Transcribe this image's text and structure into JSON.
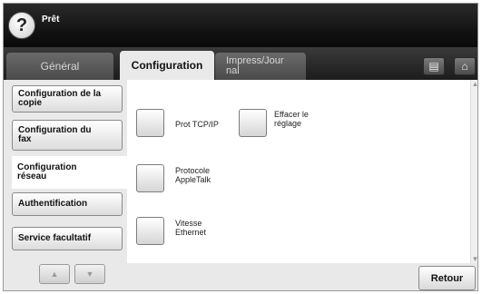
{
  "status": {
    "help_symbol": "?",
    "text": "Prêt"
  },
  "tabs": [
    {
      "label": "Général"
    },
    {
      "label": "Configuration"
    },
    {
      "label_line1": "Impress/Jour",
      "label_line2": "nal"
    }
  ],
  "tab_icons": [
    {
      "name": "copy-job-icon",
      "glyph": "▤"
    },
    {
      "name": "home-icon",
      "glyph": "⌂"
    }
  ],
  "sidebar": {
    "items": [
      {
        "line1": "Configuration de la",
        "line2": "copie"
      },
      {
        "line1": "Configuration du",
        "line2": "fax"
      },
      {
        "line1": "Configuration",
        "line2": "réseau"
      },
      {
        "line1": "Authentification",
        "line2": ""
      },
      {
        "line1": "Service facultatif",
        "line2": ""
      }
    ],
    "active_index": 2,
    "up_arrow": "▲",
    "down_arrow": "▼"
  },
  "options": [
    {
      "line1": "Prot TCP/IP",
      "line2": ""
    },
    {
      "line1": "Effacer le",
      "line2": "réglage"
    },
    {
      "line1": "Protocole",
      "line2": "AppleTalk"
    },
    {
      "line1": "Vitesse",
      "line2": "Ethernet"
    }
  ],
  "scroll": {
    "up": "▲",
    "down": "▼"
  },
  "footer": {
    "back_label": "Retour"
  }
}
